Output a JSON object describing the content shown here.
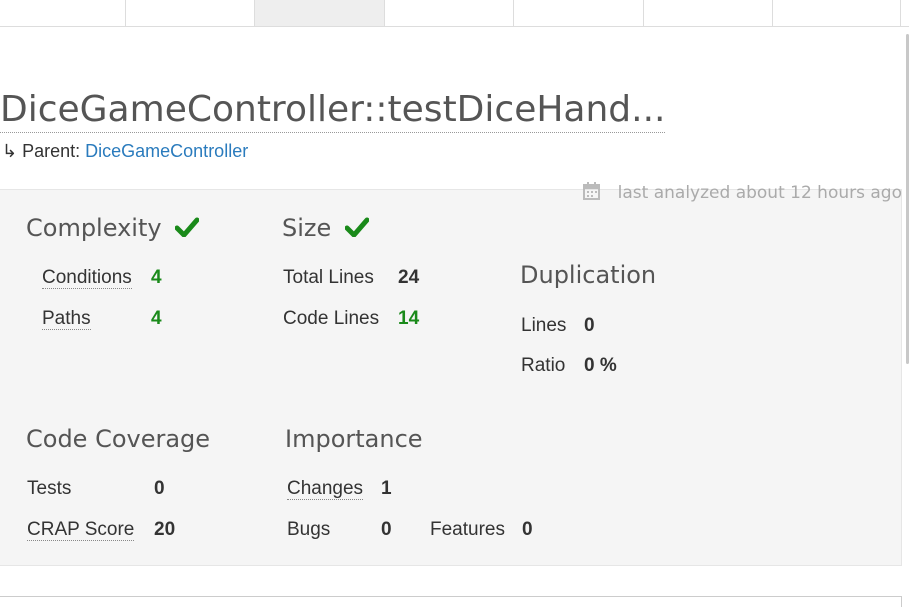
{
  "header": {
    "title": "DiceGameController::testDiceHand...",
    "parent_prefix": "↳ Parent:",
    "parent_link": "DiceGameController"
  },
  "meta": {
    "analyzed": "last analyzed about 12 hours ago",
    "calendar_icon": "calendar-icon"
  },
  "complexity": {
    "title": "Complexity",
    "conditions_label": "Conditions",
    "conditions_value": "4",
    "paths_label": "Paths",
    "paths_value": "4"
  },
  "size": {
    "title": "Size",
    "total_lines_label": "Total Lines",
    "total_lines_value": "24",
    "code_lines_label": "Code Lines",
    "code_lines_value": "14"
  },
  "duplication": {
    "title": "Duplication",
    "lines_label": "Lines",
    "lines_value": "0",
    "ratio_label": "Ratio",
    "ratio_value": "0 %"
  },
  "coverage": {
    "title": "Code Coverage",
    "tests_label": "Tests",
    "tests_value": "0",
    "crap_label": "CRAP Score",
    "crap_value": "20"
  },
  "importance": {
    "title": "Importance",
    "changes_label": "Changes",
    "changes_value": "1",
    "bugs_label": "Bugs",
    "bugs_value": "0",
    "features_label": "Features",
    "features_value": "0"
  },
  "colors": {
    "good": "#1a8a1a",
    "link": "#2a7bbd"
  }
}
